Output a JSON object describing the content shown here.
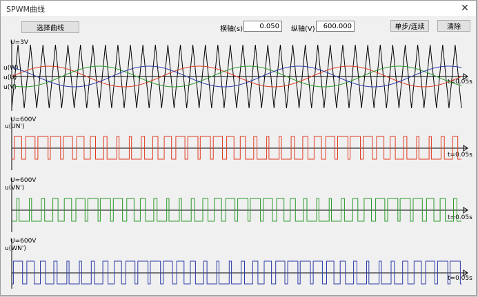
{
  "window": {
    "title": "SPWM曲线"
  },
  "toolbar": {
    "select_curve": "选择曲线",
    "x_axis_label": "横轴(s)",
    "x_axis_value": "0.050",
    "y_axis_label": "纵轴(V)",
    "y_axis_value": "600.000",
    "step_continuous": "单步/连续",
    "clear": "清除"
  },
  "panels": [
    {
      "scale_label": "U=3V",
      "signal_labels": [
        "u(W)",
        "u(U)",
        "u(V)"
      ],
      "time_label": "t=0.05s"
    },
    {
      "scale_label": "U=600V",
      "signal_labels": [
        "u(UN')"
      ],
      "time_label": "t=0.05s"
    },
    {
      "scale_label": "U=600V",
      "signal_labels": [
        "u(VN')"
      ],
      "time_label": "t=0.05s"
    },
    {
      "scale_label": "U=600V",
      "signal_labels": [
        "u(WN')"
      ],
      "time_label": "t=0.05s"
    }
  ],
  "colors": {
    "carrier": "#000000",
    "phase_u": "#e03a20",
    "phase_v": "#2a9a2a",
    "phase_w": "#2a3aa8",
    "axis": "#000000",
    "background": "#f0f0f0"
  },
  "chart_data": {
    "type": "line",
    "x_axis_span": 0.05,
    "carrier_cycles": 36,
    "modulation_cycles": 3
  }
}
